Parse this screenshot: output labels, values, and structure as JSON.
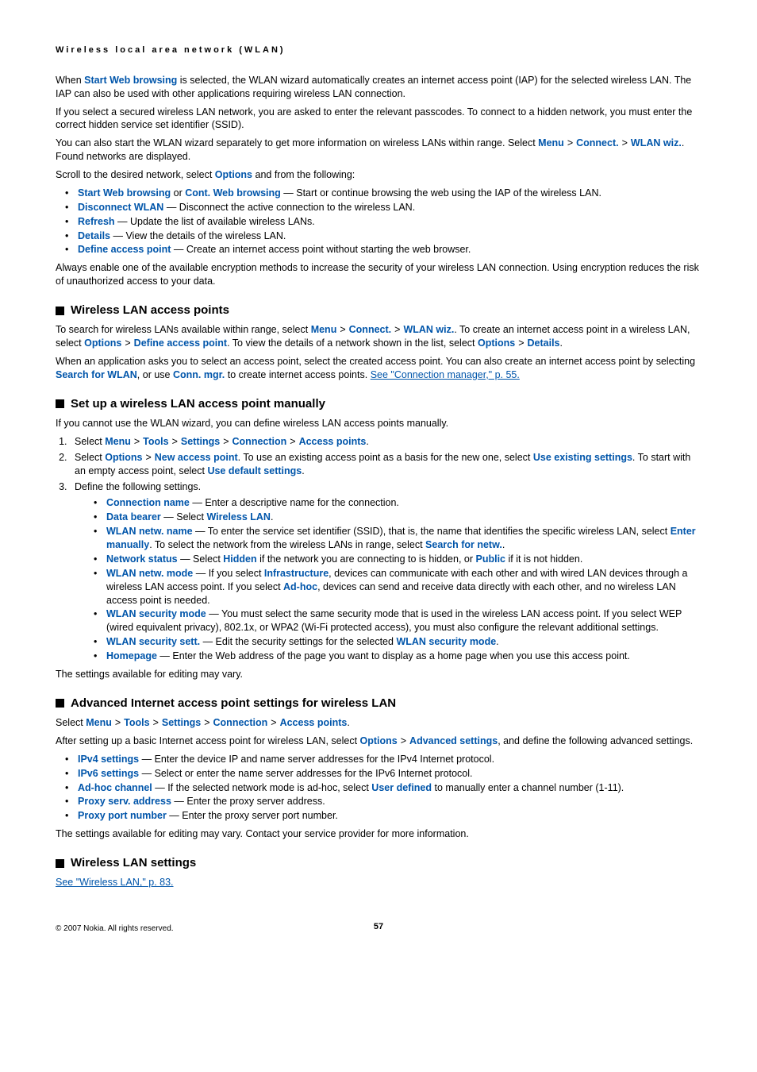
{
  "header": "Wireless local area network (WLAN)",
  "intro1_a": "When ",
  "intro1_ui": "Start Web browsing",
  "intro1_b": " is selected, the WLAN wizard automatically creates an internet access point (IAP) for the selected wireless LAN. The IAP can also be used with other applications requiring wireless LAN connection.",
  "intro2": "If you select a secured wireless LAN network, you are asked to enter the relevant passcodes. To connect to a hidden network, you must enter the correct hidden service set identifier (SSID).",
  "intro3_a": "You can also start the WLAN wizard separately to get more information on wireless LANs within range. Select ",
  "menu": "Menu",
  "connect": "Connect.",
  "wlanwiz": "WLAN wiz.",
  "intro3_b": ". Found networks are displayed.",
  "scroll_a": "Scroll to the desired network, select ",
  "options": "Options",
  "scroll_b": " and from the following:",
  "b1_a": "Start Web browsing",
  "b1_or": " or ",
  "b1_b": "Cont. Web browsing",
  "b1_t": " — Start or continue browsing the web using the IAP of the wireless LAN.",
  "b2_a": "Disconnect WLAN",
  "b2_t": " — Disconnect the active connection to the wireless LAN.",
  "b3_a": "Refresh",
  "b3_t": " — Update the list of available wireless LANs.",
  "b4_a": "Details",
  "b4_t": " — View the details of the wireless LAN.",
  "b5_a": "Define access point",
  "b5_t": " — Create an internet access point without starting the web browser.",
  "enc": "Always enable one of the available encryption methods to increase the security of your wireless LAN connection. Using encryption reduces the risk of unauthorized access to your data.",
  "h_ap": "Wireless LAN access points",
  "ap1_a": "To search for wireless LANs available within range, select ",
  "ap1_b": ". To create an internet access point in a wireless LAN, select ",
  "dap": "Define access point",
  "ap1_c": ". To view the details of a network shown in the list, select ",
  "details": "Details",
  "ap2_a": "When an application asks you to select an access point, select the created access point. You can also create an internet access point by selecting ",
  "sfw": "Search for WLAN",
  "ap2_b": ", or use ",
  "connmgr": "Conn. mgr.",
  "ap2_c": " to create internet access points. ",
  "ap2_link": "See \"Connection manager,\" p. 55.",
  "h_setup": "Set up a wireless LAN access point manually",
  "su_intro": "If you cannot use the WLAN wizard, you can define wireless LAN access points manually.",
  "su1_pre": "Select ",
  "tools": "Tools",
  "settings": "Settings",
  "connection": "Connection",
  "apoints": "Access points",
  "su2_a": "Select ",
  "nap": "New access point",
  "su2_b": ". To use an existing access point as a basis for the new one, select ",
  "ues": "Use existing settings",
  "su2_c": ". To start with an empty access point, select ",
  "uds": "Use default settings",
  "su3": "Define the following settings.",
  "s1_a": "Connection name",
  "s1_t": " — Enter a descriptive name for the connection.",
  "s2_a": "Data bearer",
  "s2_t": " — Select ",
  "s2_b": "Wireless LAN",
  "s3_a": "WLAN netw. name",
  "s3_t": " — To enter the service set identifier (SSID), that is, the name that identifies the specific wireless LAN, select ",
  "s3_b": "Enter manually",
  "s3_t2": ". To select the network from the wireless LANs in range, select ",
  "s3_c": "Search for netw.",
  "s4_a": "Network status",
  "s4_t": " — Select ",
  "s4_b": "Hidden",
  "s4_t2": " if the network you are connecting to is hidden, or ",
  "s4_c": "Public",
  "s4_t3": " if it is not hidden.",
  "s5_a": "WLAN netw. mode",
  "s5_t": " — If you select ",
  "s5_b": "Infrastructure",
  "s5_t2": ", devices can communicate with each other and with wired LAN devices through a wireless LAN access point. If you select ",
  "s5_c": "Ad-hoc",
  "s5_t3": ", devices can send and receive data directly with each other, and no wireless LAN access point is needed.",
  "s6_a": "WLAN security mode",
  "s6_t": " — You must select the same security mode that is used in the wireless LAN access point. If you select WEP (wired equivalent privacy), 802.1x, or WPA2 (Wi-Fi protected access), you must also configure the relevant additional settings.",
  "s7_a": "WLAN security sett.",
  "s7_t": " — Edit the security settings for the selected ",
  "s7_b": "WLAN security mode",
  "s8_a": "Homepage",
  "s8_t": " — Enter the Web address of the page you want to display as a home page when you use this access point.",
  "vary": "The settings available for editing may vary.",
  "h_adv": "Advanced Internet access point settings for wireless LAN",
  "adv_sel": "Select ",
  "adv1_a": "After setting up a basic Internet access point for wireless LAN, select ",
  "advset": "Advanced settings",
  "adv1_b": ", and define the following advanced settings.",
  "a1_a": "IPv4 settings",
  "a1_t": " — Enter the device IP and name server addresses for the IPv4 Internet protocol.",
  "a2_a": "IPv6 settings",
  "a2_t": " — Select or enter the name server addresses for the IPv6 Internet protocol.",
  "a3_a": "Ad-hoc channel",
  "a3_t": " — If the selected network mode is ad-hoc, select ",
  "a3_b": "User defined",
  "a3_t2": " to manually enter a channel number (1-11).",
  "a4_a": "Proxy serv. address",
  "a4_t": " — Enter the proxy server address.",
  "a5_a": "Proxy port number",
  "a5_t": " — Enter the proxy server port number.",
  "advvary": "The settings available for editing may vary. Contact your service provider for more information.",
  "h_wset": "Wireless LAN settings",
  "wset_link": "See \"Wireless LAN,\" p. 83.",
  "copy": "© 2007 Nokia. All rights reserved.",
  "page": "57"
}
